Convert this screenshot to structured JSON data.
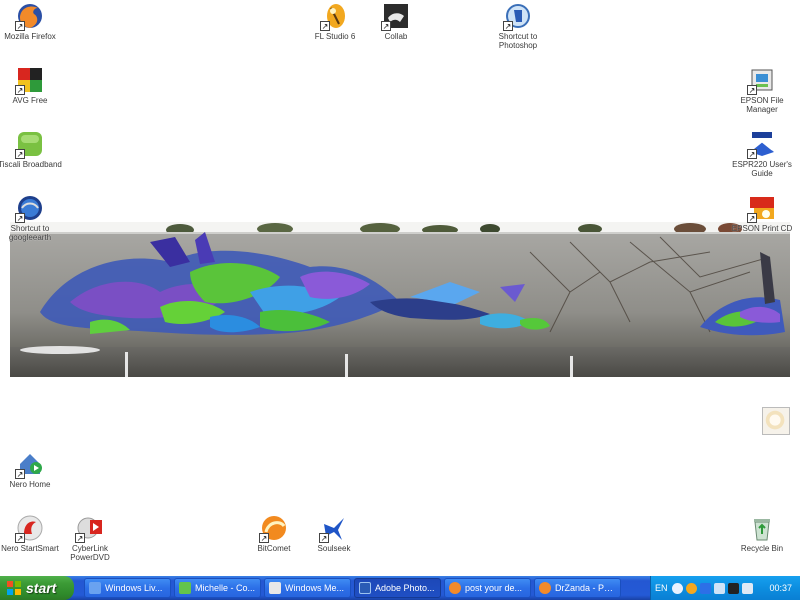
{
  "desktop": {
    "icons": [
      {
        "label": "Mozilla Firefox",
        "icon": "firefox-icon"
      },
      {
        "label": "AVG Free",
        "icon": "avg-icon"
      },
      {
        "label": "Tiscali Broadband",
        "icon": "tiscali-icon"
      },
      {
        "label": "Shortcut to googleearth",
        "icon": "google-earth-icon"
      },
      {
        "label": "FL Studio 6",
        "icon": "fl-studio-icon"
      },
      {
        "label": "Collab",
        "icon": "collab-icon"
      },
      {
        "label": "Shortcut to Photoshop",
        "icon": "photoshop-icon"
      },
      {
        "label": "EPSON File Manager",
        "icon": "epson-file-manager-icon"
      },
      {
        "label": "ESPR220 User's Guide",
        "icon": "epson-guide-icon"
      },
      {
        "label": "EPSON Print CD",
        "icon": "epson-print-cd-icon"
      },
      {
        "label": "Nero Home",
        "icon": "nero-home-icon"
      },
      {
        "label": "Nero StartSmart",
        "icon": "nero-startsmart-icon"
      },
      {
        "label": "CyberLink PowerDVD",
        "icon": "powerdvd-icon"
      },
      {
        "label": "BitComet",
        "icon": "bitcomet-icon"
      },
      {
        "label": "Soulseek",
        "icon": "soulseek-icon"
      },
      {
        "label": "Recycle Bin",
        "icon": "recycle-bin-icon"
      }
    ]
  },
  "taskbar": {
    "start_label": "start",
    "tasks": [
      {
        "label": "Windows Liv...",
        "icon": "windows-live-icon",
        "color": "#6aa2f0"
      },
      {
        "label": "Michelle - Co...",
        "icon": "messenger-icon",
        "color": "#63c44a"
      },
      {
        "label": "Windows Me...",
        "icon": "media-player-icon",
        "color": "#e8e8e8"
      },
      {
        "label": "Adobe Photo...",
        "icon": "photoshop-icon",
        "color": "#2a5bb5",
        "active": true
      },
      {
        "label": "post your de...",
        "icon": "firefox-icon",
        "color": "#f28a2a"
      },
      {
        "label": "DrZanda - Ph...",
        "icon": "firefox-icon",
        "color": "#f28a2a"
      }
    ],
    "tray": {
      "language": "EN",
      "clock": "00:37"
    }
  },
  "colors": {
    "taskbar_blue": "#245ad6",
    "start_green": "#3c9b36",
    "tray_blue": "#0d8ee0"
  }
}
